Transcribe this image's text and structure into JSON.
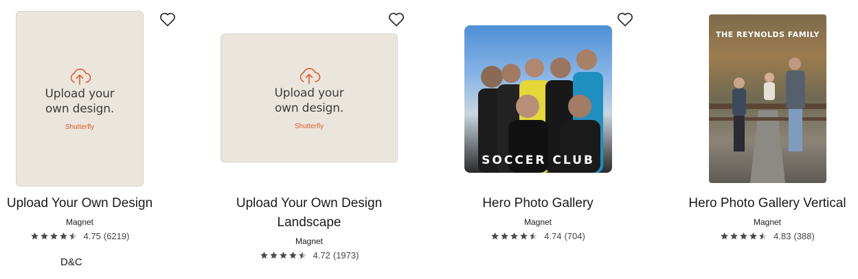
{
  "products": [
    {
      "title_lines": [
        "Upload Your Own Design"
      ],
      "type": "Magnet",
      "rating": "4.75",
      "reviews": "(6219)",
      "thumb": {
        "line1": "Upload your",
        "line2": "own design.",
        "brand": "Shutterfly"
      },
      "extra": "D&C"
    },
    {
      "title_lines": [
        "Upload Your Own Design",
        "Landscape"
      ],
      "type": "Magnet",
      "rating": "4.72",
      "reviews": "(1973)",
      "thumb": {
        "line1": "Upload your",
        "line2": "own design.",
        "brand": "Shutterfly"
      }
    },
    {
      "title_lines": [
        "Hero Photo Gallery"
      ],
      "type": "Magnet",
      "rating": "4.74",
      "reviews": "(704)",
      "thumb": {
        "overlay": "SOCCER CLUB"
      }
    },
    {
      "title_lines": [
        "Hero Photo Gallery Vertical"
      ],
      "type": "Magnet",
      "rating": "4.83",
      "reviews": "(388)",
      "thumb": {
        "overlay": "THE REYNOLDS FAMILY"
      }
    }
  ],
  "colors": {
    "accent": "#e0592f",
    "star": "#4a4a4a",
    "thumb_bg": "#ebe6dd"
  },
  "icons": {
    "favorite": "heart-outline-icon",
    "upload": "cloud-upload-icon",
    "rating": "star-icon"
  }
}
